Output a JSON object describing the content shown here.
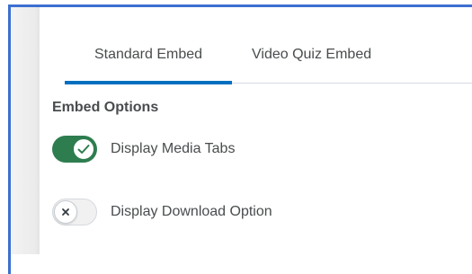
{
  "tabs": [
    {
      "label": "Standard Embed",
      "active": true
    },
    {
      "label": "Video Quiz Embed",
      "active": false
    }
  ],
  "section": {
    "title": "Embed Options"
  },
  "options": [
    {
      "label": "Display Media Tabs",
      "checked": true
    },
    {
      "label": "Display Download Option",
      "checked": false
    }
  ],
  "colors": {
    "accent_blue": "#006fbf",
    "toggle_green": "#2e7d4f",
    "frame_blue": "#3c6fd1",
    "text": "#494c4e"
  },
  "icons": {
    "on_knob": "checkmark-icon",
    "off_knob": "x-icon"
  }
}
